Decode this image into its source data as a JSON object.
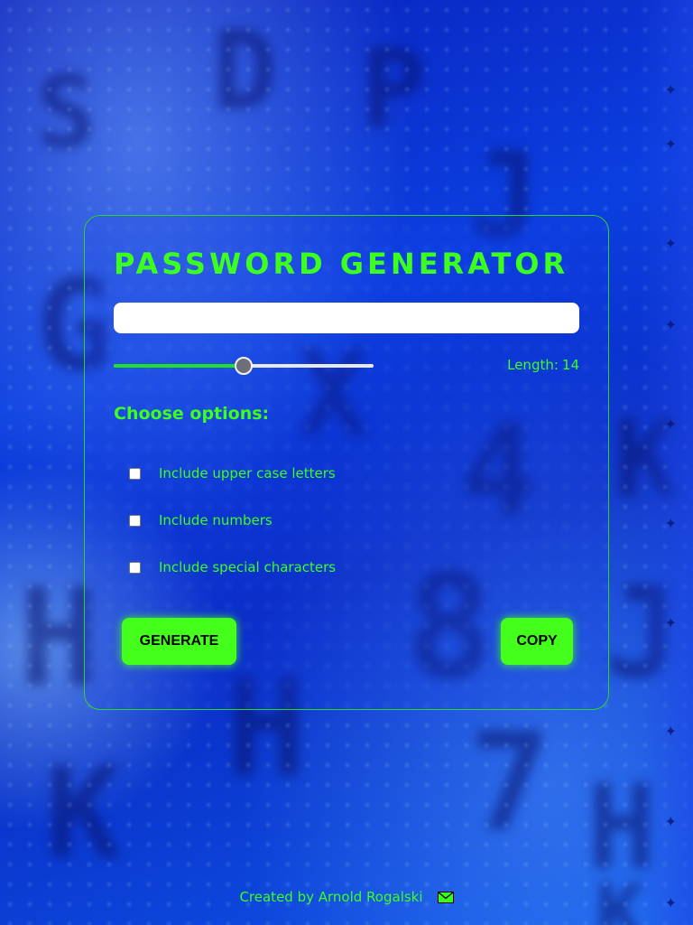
{
  "app": {
    "title": "PASSWORD GENERATOR"
  },
  "password": {
    "value": "",
    "placeholder": ""
  },
  "length": {
    "label": "Length:",
    "value": "14",
    "slider_fraction": 0.5
  },
  "options": {
    "title": "Choose options:",
    "items": [
      {
        "label": "Include upper case letters",
        "checked": false
      },
      {
        "label": "Include numbers",
        "checked": false
      },
      {
        "label": "Include special characters",
        "checked": false
      }
    ]
  },
  "buttons": {
    "generate": "GENERATE",
    "copy": "COPY"
  },
  "footer": {
    "credit": "Created by Arnold Rogalski",
    "icon": "envelope-icon"
  },
  "colors": {
    "accent": "#3cff1e",
    "button_bg": "#44ff1c",
    "background": "#0b3fe0",
    "card_border": "#2bd62b"
  }
}
